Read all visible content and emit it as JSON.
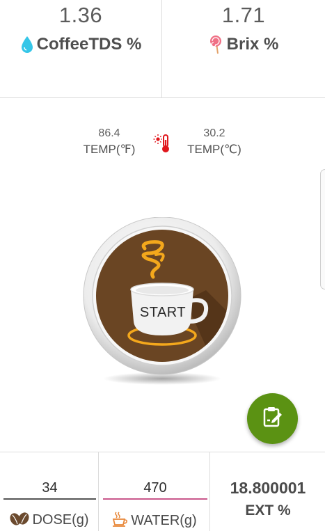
{
  "readings": {
    "tds": {
      "value": "1.36",
      "label": "CoffeeTDS %",
      "icon": "water-drop-icon",
      "icon_color": "#35c6e8"
    },
    "brix": {
      "value": "1.71",
      "label": "Brix %",
      "icon": "lollipop-icon",
      "icon_color": "#e8607a"
    }
  },
  "temperature": {
    "fahrenheit": {
      "value": "86.4",
      "label": "TEMP(℉)"
    },
    "celsius": {
      "value": "30.2",
      "label": "TEMP(℃)"
    },
    "icon": "thermometer-icon",
    "icon_color": "#e0161c"
  },
  "start_button": {
    "label": "START",
    "accent": "#5c3d1f",
    "steam_color": "#f4a81c"
  },
  "fab": {
    "icon": "clipboard-edit-icon",
    "color": "#5b9213"
  },
  "inputs": {
    "dose": {
      "value": "34",
      "label": "DOSE(g)",
      "icon": "coffee-beans-icon"
    },
    "water": {
      "value": "470",
      "label": "WATER(g)",
      "icon": "coffee-cup-icon",
      "underline": "#c9578b"
    }
  },
  "extraction": {
    "value": "18.800001",
    "label": "EXT %"
  }
}
